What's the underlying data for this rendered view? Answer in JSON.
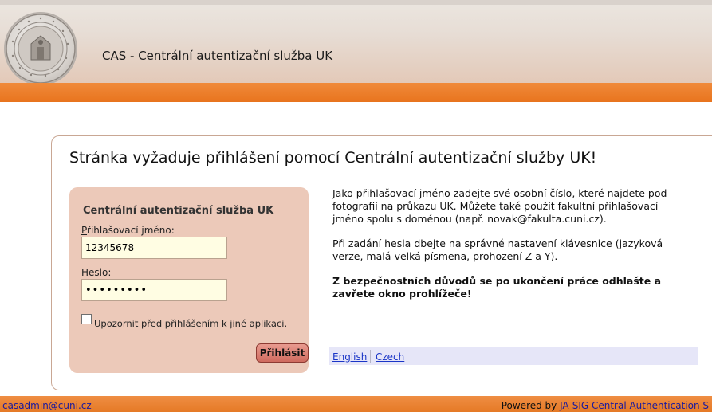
{
  "header": {
    "title": "CAS - Centrální autentizační služba UK"
  },
  "main": {
    "heading": "Stránka vyžaduje přihlášení pomocí Centrální autentizační služby UK!"
  },
  "login": {
    "box_title": "Centrální autentizační služba UK",
    "username_label_first": "P",
    "username_label_rest": "řihlašovací jméno:",
    "username_value": "12345678",
    "password_label_first": "H",
    "password_label_rest": "eslo:",
    "password_value": "•••••••••",
    "remember_label_first": "U",
    "remember_label_rest": "pozornit před přihlášením k jiné aplikaci.",
    "remember_checked": false,
    "submit_label": "Přihlásit"
  },
  "info": {
    "paragraph1": "Jako přihlašovací jméno zadejte své osobní číslo, které najdete pod fotografií na průkazu UK. Můžete také použít fakultní přihlašovací jméno spolu s doménou (např. novak@fakulta.cuni.cz).",
    "paragraph2": "Při zadání hesla dbejte na správné nastavení klávesnice (jazyková verze, malá-velká písmena, prohození Z a Y).",
    "warning": "Z bezpečnostních důvodů se po ukončení práce odhlašte a zavřete okno prohlížeče!"
  },
  "languages": [
    "English",
    "Czech"
  ],
  "footer": {
    "email": "casadmin@cuni.cz",
    "powered_prefix": "Powered by ",
    "powered_link": "JA-SIG Central Authentication S"
  },
  "colors": {
    "orange_stripe": "#e8741e",
    "login_box": "#ecc9b9",
    "link": "#1a35c7"
  }
}
